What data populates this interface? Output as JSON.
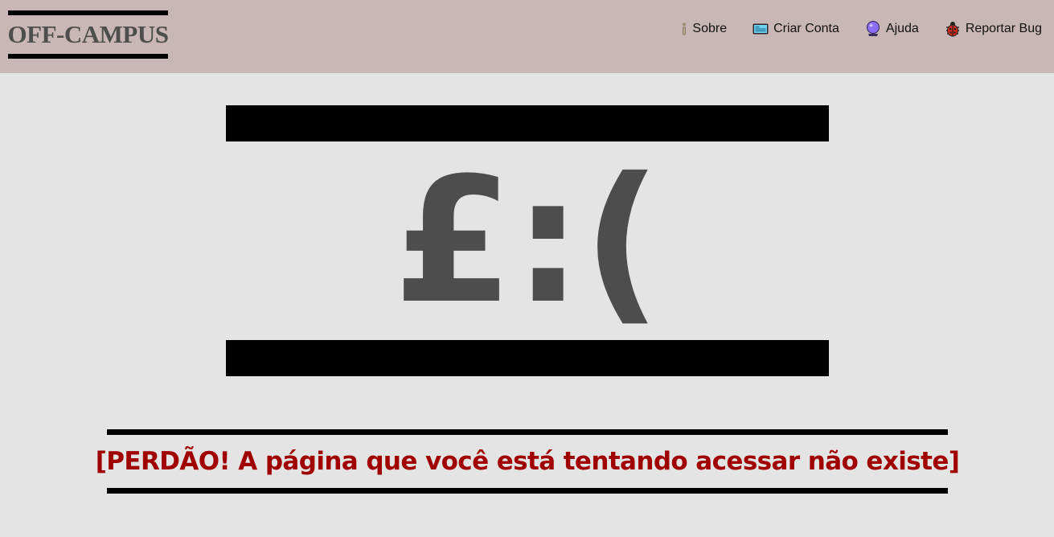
{
  "header": {
    "logo_text": "OFF-CAMPUS",
    "nav": [
      {
        "label": "Sobre",
        "icon": "info-icon"
      },
      {
        "label": "Criar Conta",
        "icon": "id-card-icon"
      },
      {
        "label": "Ajuda",
        "icon": "crystal-ball-icon"
      },
      {
        "label": "Reportar Bug",
        "icon": "ladybug-icon"
      }
    ]
  },
  "error": {
    "face": "£:(",
    "message": "[PERDÃO! A página que você está tentando acessar não existe]"
  },
  "colors": {
    "header_bg": "#c8b7b6",
    "page_bg": "#e4e4e4",
    "face": "#4d4d4d",
    "message": "#a00000"
  }
}
